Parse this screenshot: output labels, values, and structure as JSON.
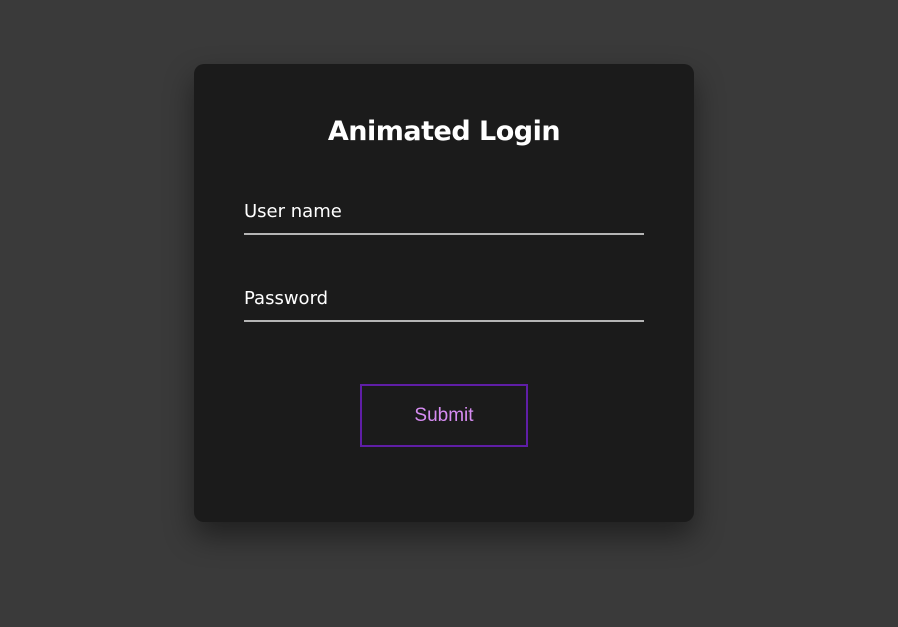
{
  "login": {
    "title": "Animated Login",
    "username": {
      "label": "User name",
      "value": ""
    },
    "password": {
      "label": "Password",
      "value": ""
    },
    "submit_label": "Submit"
  },
  "colors": {
    "page_background": "#3a3a3a",
    "card_background": "#1b1b1b",
    "text": "#ffffff",
    "underline": "#b5b5b5",
    "button_border": "#5f1ea6",
    "button_text": "#d68cf2"
  }
}
